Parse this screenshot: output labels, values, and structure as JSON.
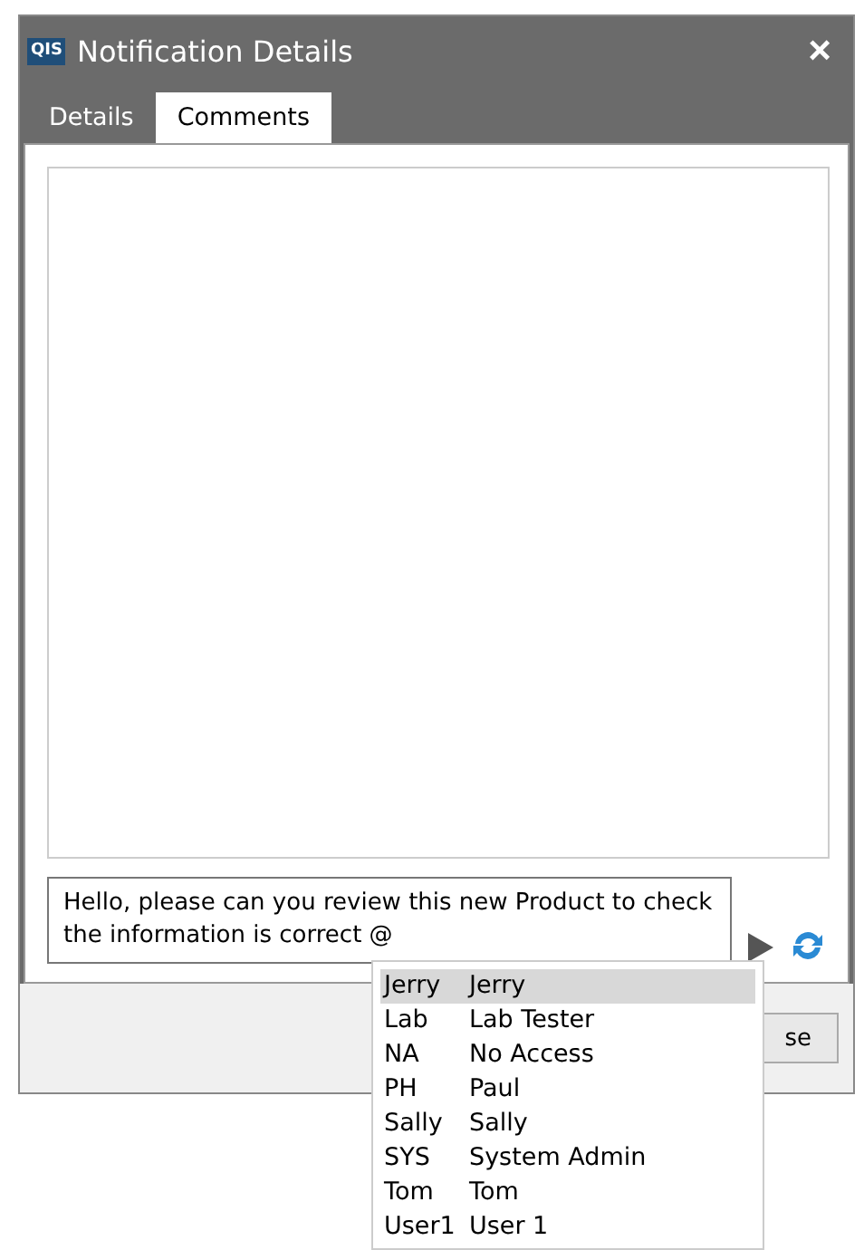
{
  "window": {
    "logo": "QIS",
    "title": "Notification Details",
    "close": "×"
  },
  "tabs": [
    {
      "label": "Details",
      "selected": false
    },
    {
      "label": "Comments",
      "selected": true
    }
  ],
  "comment_input": {
    "value": "Hello, please can you review this new Product to check the information is correct @"
  },
  "footer_button": {
    "label": "se"
  },
  "mention_list": [
    {
      "code": "Jerry",
      "name": "Jerry",
      "selected": true
    },
    {
      "code": "Lab",
      "name": "Lab Tester",
      "selected": false
    },
    {
      "code": "NA",
      "name": "No Access",
      "selected": false
    },
    {
      "code": "PH",
      "name": "Paul",
      "selected": false
    },
    {
      "code": "Sally",
      "name": "Sally",
      "selected": false
    },
    {
      "code": "SYS",
      "name": "System Admin",
      "selected": false
    },
    {
      "code": "Tom",
      "name": "Tom",
      "selected": false
    },
    {
      "code": "User1",
      "name": "User 1",
      "selected": false
    }
  ]
}
